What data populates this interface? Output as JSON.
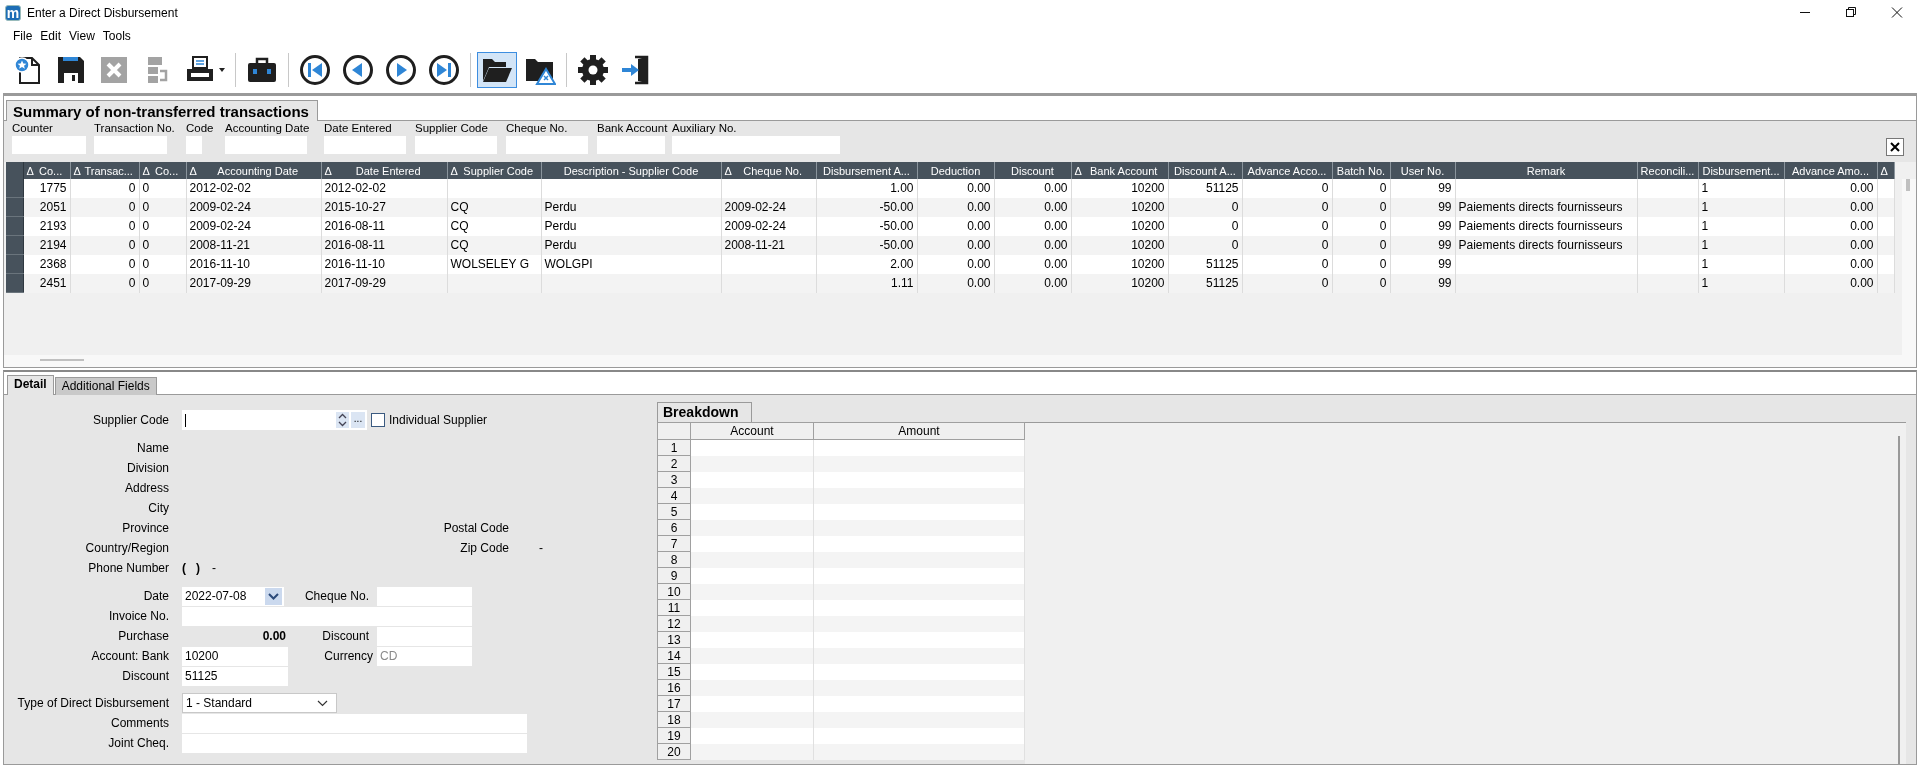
{
  "window": {
    "logo": "m",
    "title": "Enter a Direct Disbursement"
  },
  "menu": [
    "File",
    "Edit",
    "View",
    "Tools"
  ],
  "toolbar": [
    {
      "kind": "new",
      "disabled": false,
      "selected": false,
      "dropdown": false
    },
    {
      "kind": "save",
      "disabled": false,
      "selected": false,
      "dropdown": false
    },
    {
      "kind": "delete",
      "disabled": true,
      "selected": false,
      "dropdown": false
    },
    {
      "kind": "transfer",
      "disabled": true,
      "selected": false,
      "dropdown": false
    },
    {
      "kind": "print",
      "disabled": false,
      "selected": false,
      "dropdown": true
    },
    {
      "kind": "separator"
    },
    {
      "kind": "briefcase",
      "disabled": false,
      "selected": false,
      "dropdown": false
    },
    {
      "kind": "separator"
    },
    {
      "kind": "first",
      "disabled": false,
      "selected": false,
      "dropdown": false
    },
    {
      "kind": "previous",
      "disabled": false,
      "selected": false,
      "dropdown": false
    },
    {
      "kind": "next",
      "disabled": false,
      "selected": false,
      "dropdown": false
    },
    {
      "kind": "last",
      "disabled": false,
      "selected": false,
      "dropdown": false
    },
    {
      "kind": "separator"
    },
    {
      "kind": "open",
      "disabled": false,
      "selected": true,
      "dropdown": false
    },
    {
      "kind": "warning",
      "disabled": false,
      "selected": false,
      "dropdown": false
    },
    {
      "kind": "separator"
    },
    {
      "kind": "settings",
      "disabled": false,
      "selected": false,
      "dropdown": false
    },
    {
      "kind": "exit",
      "disabled": false,
      "selected": false,
      "dropdown": false
    }
  ],
  "summary": {
    "title": "Summary of non-transferred transactions",
    "filters": [
      {
        "label": "Counter"
      },
      {
        "label": "Transaction No."
      },
      {
        "label": "Code"
      },
      {
        "label": "Accounting Date"
      },
      {
        "label": "Date Entered"
      },
      {
        "label": "Supplier Code"
      },
      {
        "label": "Cheque No."
      },
      {
        "label": "Bank Account"
      },
      {
        "label": "Auxiliary No."
      }
    ],
    "table": {
      "columns": [
        {
          "sort_mark": "Δ",
          "label": "Co...",
          "kind": "number"
        },
        {
          "sort_mark": "Δ",
          "label": "Transac...",
          "kind": "number"
        },
        {
          "sort_mark": "Δ",
          "label": "Co...",
          "kind": "text"
        },
        {
          "sort_mark": "Δ",
          "label": "Accounting Date",
          "kind": "text"
        },
        {
          "sort_mark": "Δ",
          "label": "Date Entered",
          "kind": "text"
        },
        {
          "sort_mark": "Δ",
          "label": "Supplier Code",
          "kind": "text"
        },
        {
          "label": "Description - Supplier Code",
          "kind": "text"
        },
        {
          "sort_mark": "Δ",
          "label": "Cheque No.",
          "kind": "text"
        },
        {
          "label": "Disbursement A...",
          "kind": "number"
        },
        {
          "label": "Deduction",
          "kind": "number"
        },
        {
          "label": "Discount",
          "kind": "number"
        },
        {
          "sort_mark": "Δ",
          "label": "Bank Account",
          "kind": "number"
        },
        {
          "label": "Discount A...",
          "kind": "number"
        },
        {
          "label": "Advance Acco...",
          "kind": "number"
        },
        {
          "label": "Batch No.",
          "kind": "number"
        },
        {
          "label": "User No.",
          "kind": "number"
        },
        {
          "label": "Remark",
          "kind": "text"
        },
        {
          "label": "Reconcili...",
          "kind": "text"
        },
        {
          "label": "Disbursement...",
          "kind": "text"
        },
        {
          "label": "Advance Amo...",
          "kind": "number"
        },
        {
          "sort_mark": "Δ",
          "kind": "text"
        }
      ],
      "rows": [
        [
          "1775",
          "0",
          "0",
          "2012-02-02",
          "2012-02-02",
          null,
          null,
          null,
          "1.00",
          "0.00",
          "0.00",
          "10200",
          "51125",
          "0",
          "0",
          "99",
          null,
          null,
          "1",
          "0.00",
          null
        ],
        [
          "2051",
          "0",
          "0",
          "2009-02-24",
          "2015-10-27",
          "CQ",
          "Perdu",
          "2009-02-24",
          "-50.00",
          "0.00",
          "0.00",
          "10200",
          "0",
          "0",
          "0",
          "99",
          "Paiements directs fournisseurs",
          null,
          "1",
          "0.00",
          null
        ],
        [
          "2193",
          "0",
          "0",
          "2009-02-24",
          "2016-08-11",
          "CQ",
          "Perdu",
          "2009-02-24",
          "-50.00",
          "0.00",
          "0.00",
          "10200",
          "0",
          "0",
          "0",
          "99",
          "Paiements directs fournisseurs",
          null,
          "1",
          "0.00",
          null
        ],
        [
          "2194",
          "0",
          "0",
          "2008-11-21",
          "2016-08-11",
          "CQ",
          "Perdu",
          "2008-11-21",
          "-50.00",
          "0.00",
          "0.00",
          "10200",
          "0",
          "0",
          "0",
          "99",
          "Paiements directs fournisseurs",
          null,
          "1",
          "0.00",
          null
        ],
        [
          "2368",
          "0",
          "0",
          "2016-11-10",
          "2016-11-10",
          "WOLSELEY G",
          "WOLGPI",
          null,
          "2.00",
          "0.00",
          "0.00",
          "10200",
          "51125",
          "0",
          "0",
          "99",
          null,
          null,
          "1",
          "0.00",
          null
        ],
        [
          "2451",
          "0",
          "0",
          "2017-09-29",
          "2017-09-29",
          null,
          null,
          null,
          "1.11",
          "0.00",
          "0.00",
          "10200",
          "51125",
          "0",
          "0",
          "99",
          null,
          null,
          "1",
          "0.00",
          null
        ]
      ]
    }
  },
  "detail_tabs": [
    {
      "label": "Detail",
      "selected": true
    },
    {
      "label": "Additional Fields",
      "selected": false
    }
  ],
  "form": {
    "supplier": {
      "label": "Supplier Code",
      "browse": "...",
      "checkbox": {
        "label": "Individual Supplier",
        "checked": false
      }
    },
    "info": [
      {
        "label": "Name"
      },
      {
        "label": "Division"
      },
      {
        "label": "Address"
      },
      {
        "label": "City"
      },
      {
        "label": "Province",
        "right_label": "Postal Code"
      },
      {
        "label": "Country/Region",
        "right_label": "Zip Code",
        "right_value": "-"
      }
    ],
    "phone": {
      "label": "Phone Number",
      "area": "(   )",
      "separator": "-"
    },
    "date": {
      "label": "Date",
      "value": "2022-07-08"
    },
    "cheque": {
      "label": "Cheque No."
    },
    "invoice": {
      "label": "Invoice No."
    },
    "purchase": {
      "label": "Purchase",
      "value": "0.00"
    },
    "discount": {
      "label": "Discount"
    },
    "bank": {
      "label": "Account: Bank",
      "value": "10200"
    },
    "currency": {
      "label": "Currency",
      "value": "CD",
      "disabled": true
    },
    "discount_account": {
      "label": "Discount",
      "value": "51125"
    },
    "type": {
      "label": "Type of Direct Disbursement",
      "value": "1 - Standard"
    },
    "comments": {
      "label": "Comments"
    },
    "joint": {
      "label": "Joint Cheq."
    }
  },
  "breakdown": {
    "title": "Breakdown",
    "columns": [
      "Account",
      "Amount"
    ],
    "rows": [
      "1",
      "2",
      "3",
      "4",
      "5",
      "6",
      "7",
      "8",
      "9",
      "10",
      "11",
      "12",
      "13",
      "14",
      "15",
      "16",
      "17",
      "18",
      "19",
      "20"
    ]
  }
}
